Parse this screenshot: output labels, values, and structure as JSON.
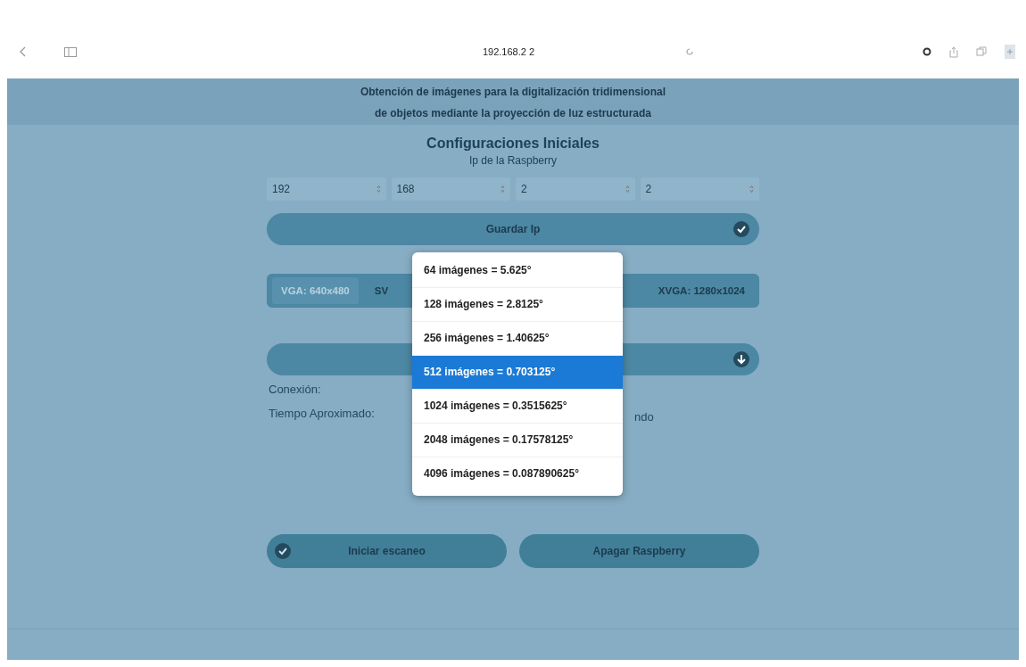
{
  "browser": {
    "address": "192.168.2 2"
  },
  "header": {
    "lines": [
      "Obtención de imágenes para la digitalización tridimensional",
      "de objetos mediante la proyección de luz estructurada"
    ]
  },
  "section": {
    "title": "Configuraciones Iniciales",
    "subtitle": "Ip de la Raspberry"
  },
  "ip_fields": [
    {
      "value": "192"
    },
    {
      "value": "168"
    },
    {
      "value": "2"
    },
    {
      "value": "2"
    }
  ],
  "save_button": {
    "label": "Guardar Ip"
  },
  "resolutions": [
    {
      "label": "VGA: 640x480",
      "selected": true
    },
    {
      "label": "SV",
      "selected": false
    },
    {
      "label": "XVGA: 1280x1024",
      "selected": false
    }
  ],
  "info": [
    {
      "label": "Conexión:"
    },
    {
      "label": "Tiempo Aproximado:",
      "value": "ndo"
    }
  ],
  "dropdown": {
    "options": [
      {
        "label": "64 imágenes = 5.625°",
        "selected": false
      },
      {
        "label": "128 imágenes = 2.8125°",
        "selected": false
      },
      {
        "label": "256 imágenes = 1.40625°",
        "selected": false
      },
      {
        "label": "512 imágenes = 0.703125°",
        "selected": true
      },
      {
        "label": "1024 imágenes = 0.3515625°",
        "selected": false
      },
      {
        "label": "2048 imágenes = 0.17578125°",
        "selected": false
      },
      {
        "label": "4096 imágenes = 0.087890625°",
        "selected": false
      }
    ]
  },
  "bottom_buttons": [
    {
      "label": "Iniciar escaneo",
      "icon": true
    },
    {
      "label": "Apagar Raspberry",
      "icon": false
    }
  ]
}
